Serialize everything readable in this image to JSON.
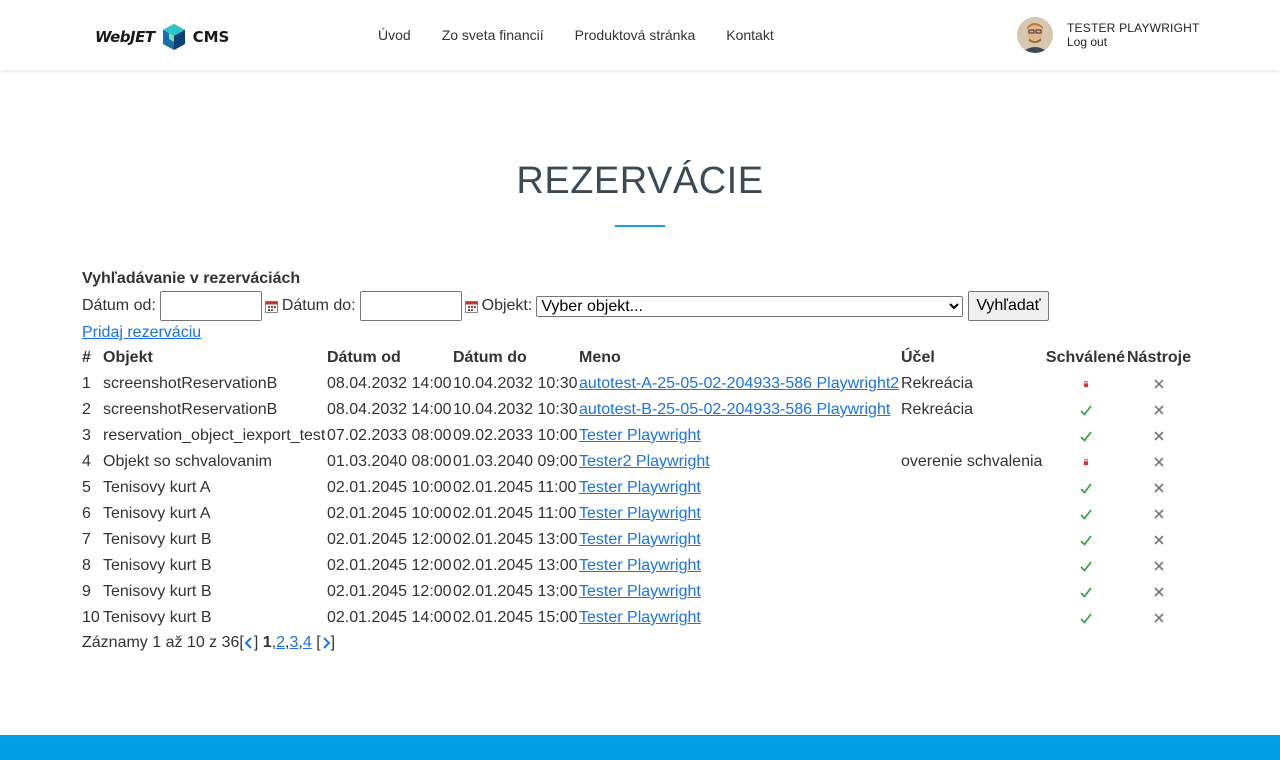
{
  "header": {
    "logo_text": "WebJET",
    "logo_cms": "CMS",
    "nav": [
      "Úvod",
      "Zo sveta financií",
      "Produktová stránka",
      "Kontakt"
    ],
    "user_name": "TESTER PLAYWRIGHT",
    "logout_label": "Log out"
  },
  "page_title": "REZERVÁCIE",
  "search": {
    "heading": "Vyhľadávanie v rezerváciách",
    "date_from_label": "Dátum od:",
    "date_from_value": "",
    "date_to_label": "Dátum do:",
    "date_to_value": "",
    "object_label": "Objekt:",
    "object_selected": "Vyber objekt...",
    "search_button": "Vyhľadať"
  },
  "add_reservation_label": "Pridaj rezerváciu",
  "table": {
    "headers": [
      "#",
      "Objekt",
      "Dátum od",
      "Dátum do",
      "Meno",
      "Účel",
      "Schválené",
      "Nástroje"
    ],
    "rows": [
      {
        "num": "1",
        "objekt": "screenshotReservationB",
        "od": "08.04.2032 14:00",
        "do": "10.04.2032 10:30",
        "meno": "autotest-A-25-05-02-204933-586 Playwright2",
        "ucel": "Rekreácia",
        "approved": false
      },
      {
        "num": "2",
        "objekt": "screenshotReservationB",
        "od": "08.04.2032 14:00",
        "do": "10.04.2032 10:30",
        "meno": "autotest-B-25-05-02-204933-586 Playwright",
        "ucel": "Rekreácia",
        "approved": true
      },
      {
        "num": "3",
        "objekt": "reservation_object_iexport_test",
        "od": "07.02.2033 08:00",
        "do": "09.02.2033 10:00",
        "meno": "Tester Playwright",
        "ucel": "",
        "approved": true
      },
      {
        "num": "4",
        "objekt": "Objekt so schvalovanim",
        "od": "01.03.2040 08:00",
        "do": "01.03.2040 09:00",
        "meno": "Tester2 Playwright",
        "ucel": "overenie schvalenia",
        "approved": false
      },
      {
        "num": "5",
        "objekt": "Tenisovy kurt A",
        "od": "02.01.2045 10:00",
        "do": "02.01.2045 11:00",
        "meno": "Tester Playwright",
        "ucel": "",
        "approved": true
      },
      {
        "num": "6",
        "objekt": "Tenisovy kurt A",
        "od": "02.01.2045 10:00",
        "do": "02.01.2045 11:00",
        "meno": "Tester Playwright",
        "ucel": "",
        "approved": true
      },
      {
        "num": "7",
        "objekt": "Tenisovy kurt B",
        "od": "02.01.2045 12:00",
        "do": "02.01.2045 13:00",
        "meno": "Tester Playwright",
        "ucel": "",
        "approved": true
      },
      {
        "num": "8",
        "objekt": "Tenisovy kurt B",
        "od": "02.01.2045 12:00",
        "do": "02.01.2045 13:00",
        "meno": "Tester Playwright",
        "ucel": "",
        "approved": true
      },
      {
        "num": "9",
        "objekt": "Tenisovy kurt B",
        "od": "02.01.2045 12:00",
        "do": "02.01.2045 13:00",
        "meno": "Tester Playwright",
        "ucel": "",
        "approved": true
      },
      {
        "num": "10",
        "objekt": "Tenisovy kurt B",
        "od": "02.01.2045 14:00",
        "do": "02.01.2045 15:00",
        "meno": "Tester Playwright",
        "ucel": "",
        "approved": true
      }
    ]
  },
  "pager": {
    "summary": "Záznamy 1 až 10 z 36",
    "current": "1",
    "pages": [
      "2",
      "3",
      "4"
    ]
  },
  "colors": {
    "accent": "#1aa0d8",
    "link": "#1a73e8",
    "footer": "#009fe3",
    "approved": "#2e9e3e",
    "pending": "#d9302f"
  }
}
